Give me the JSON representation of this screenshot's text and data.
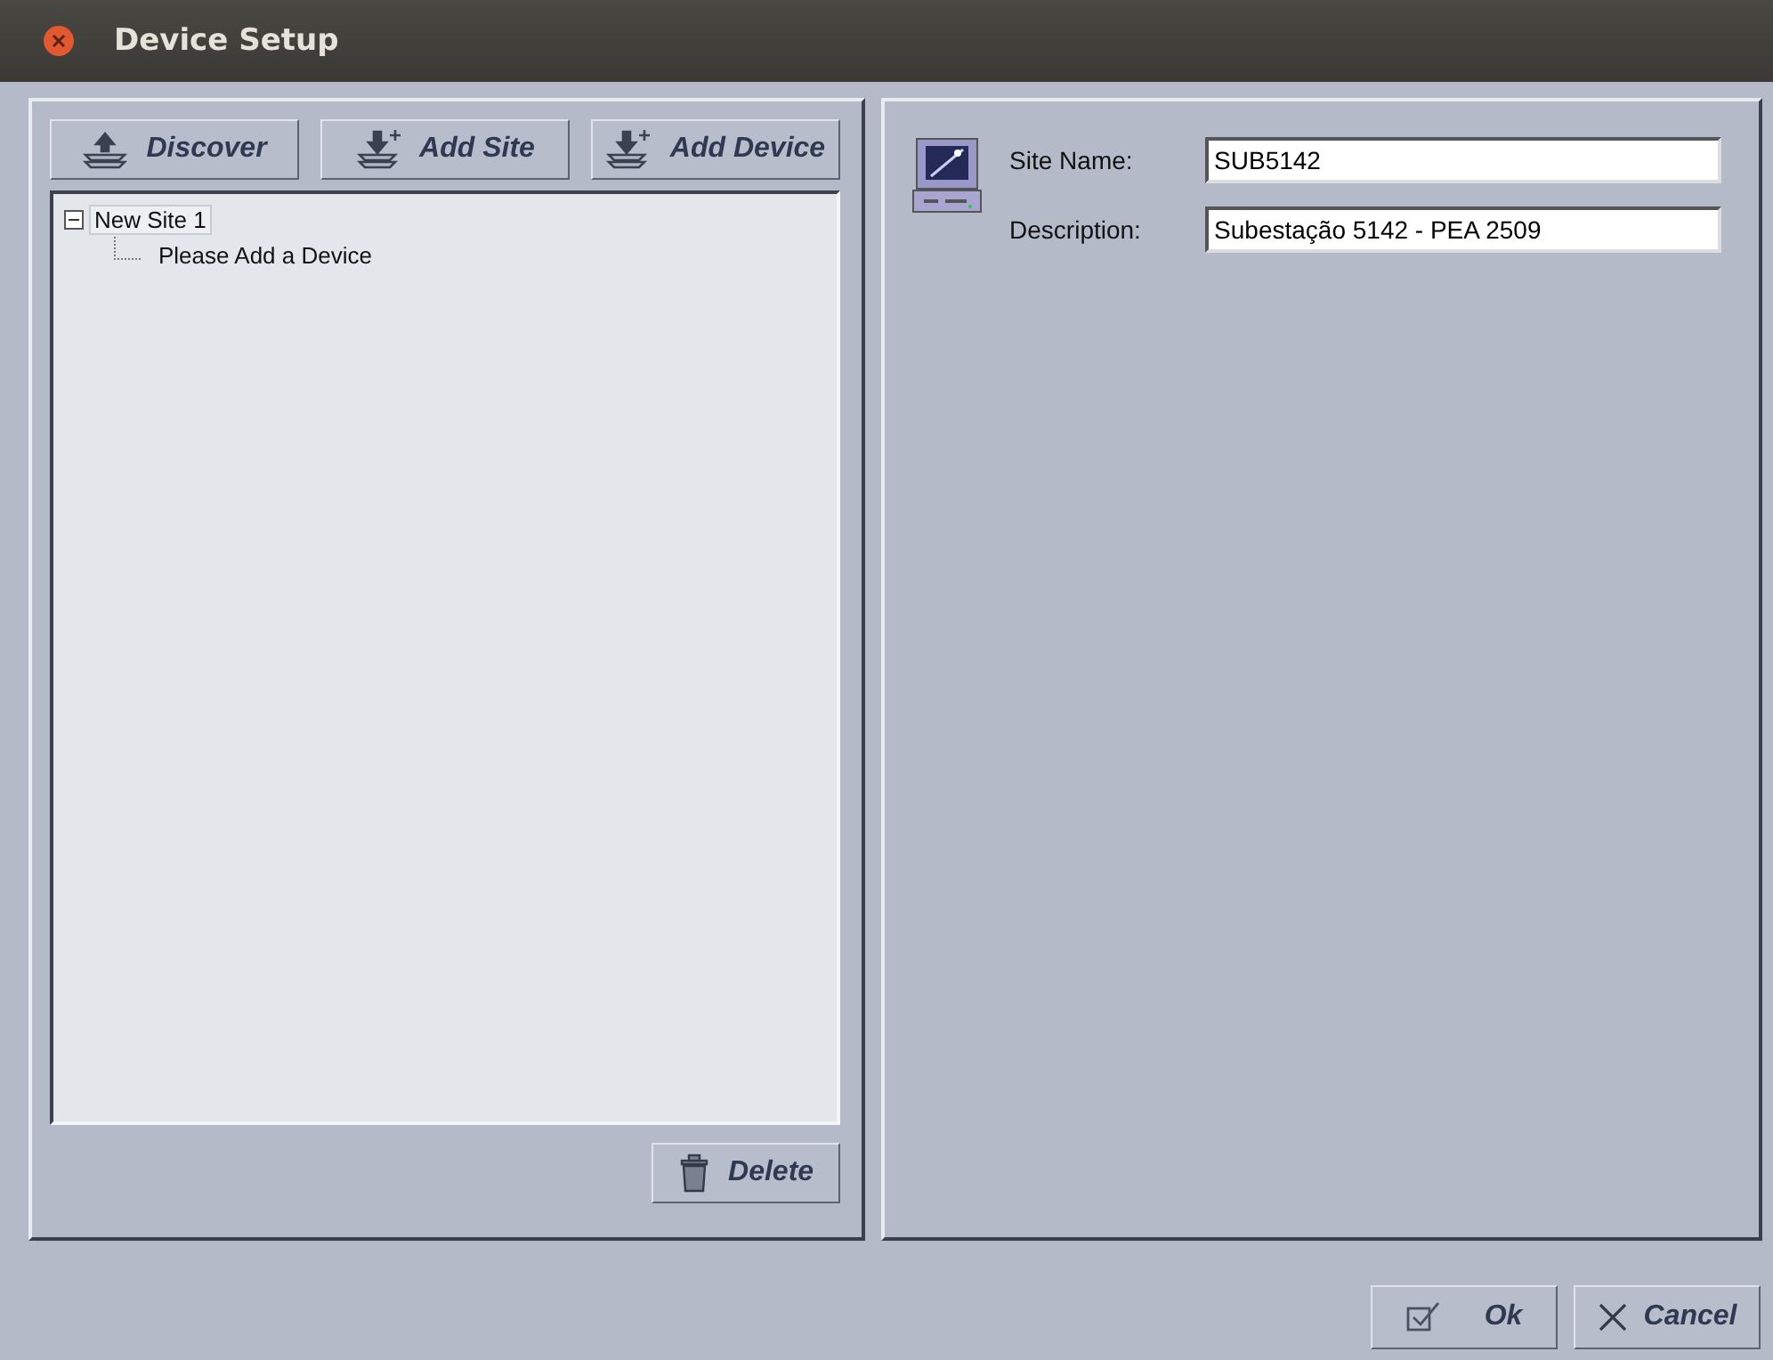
{
  "window": {
    "title": "Device Setup"
  },
  "toolbar": [
    {
      "kind": "discover",
      "label": "Discover"
    },
    {
      "kind": "add",
      "label": "Add Site"
    },
    {
      "kind": "add",
      "label": "Add Device"
    }
  ],
  "tree": [
    {
      "label": "New Site 1",
      "expanded": true,
      "selected": true,
      "children": [
        {
          "label": "Please Add a Device",
          "selected": false
        }
      ]
    }
  ],
  "delete_button": {
    "label": "Delete"
  },
  "site_form": {
    "fields": [
      {
        "label": "Site Name:",
        "value": "SUB5142"
      },
      {
        "label": "Description:",
        "value": "Subestação 5142 - PEA 2509"
      }
    ]
  },
  "buttons": [
    {
      "kind": "ok",
      "label": "Ok"
    },
    {
      "kind": "cancel",
      "label": "Cancel"
    }
  ]
}
